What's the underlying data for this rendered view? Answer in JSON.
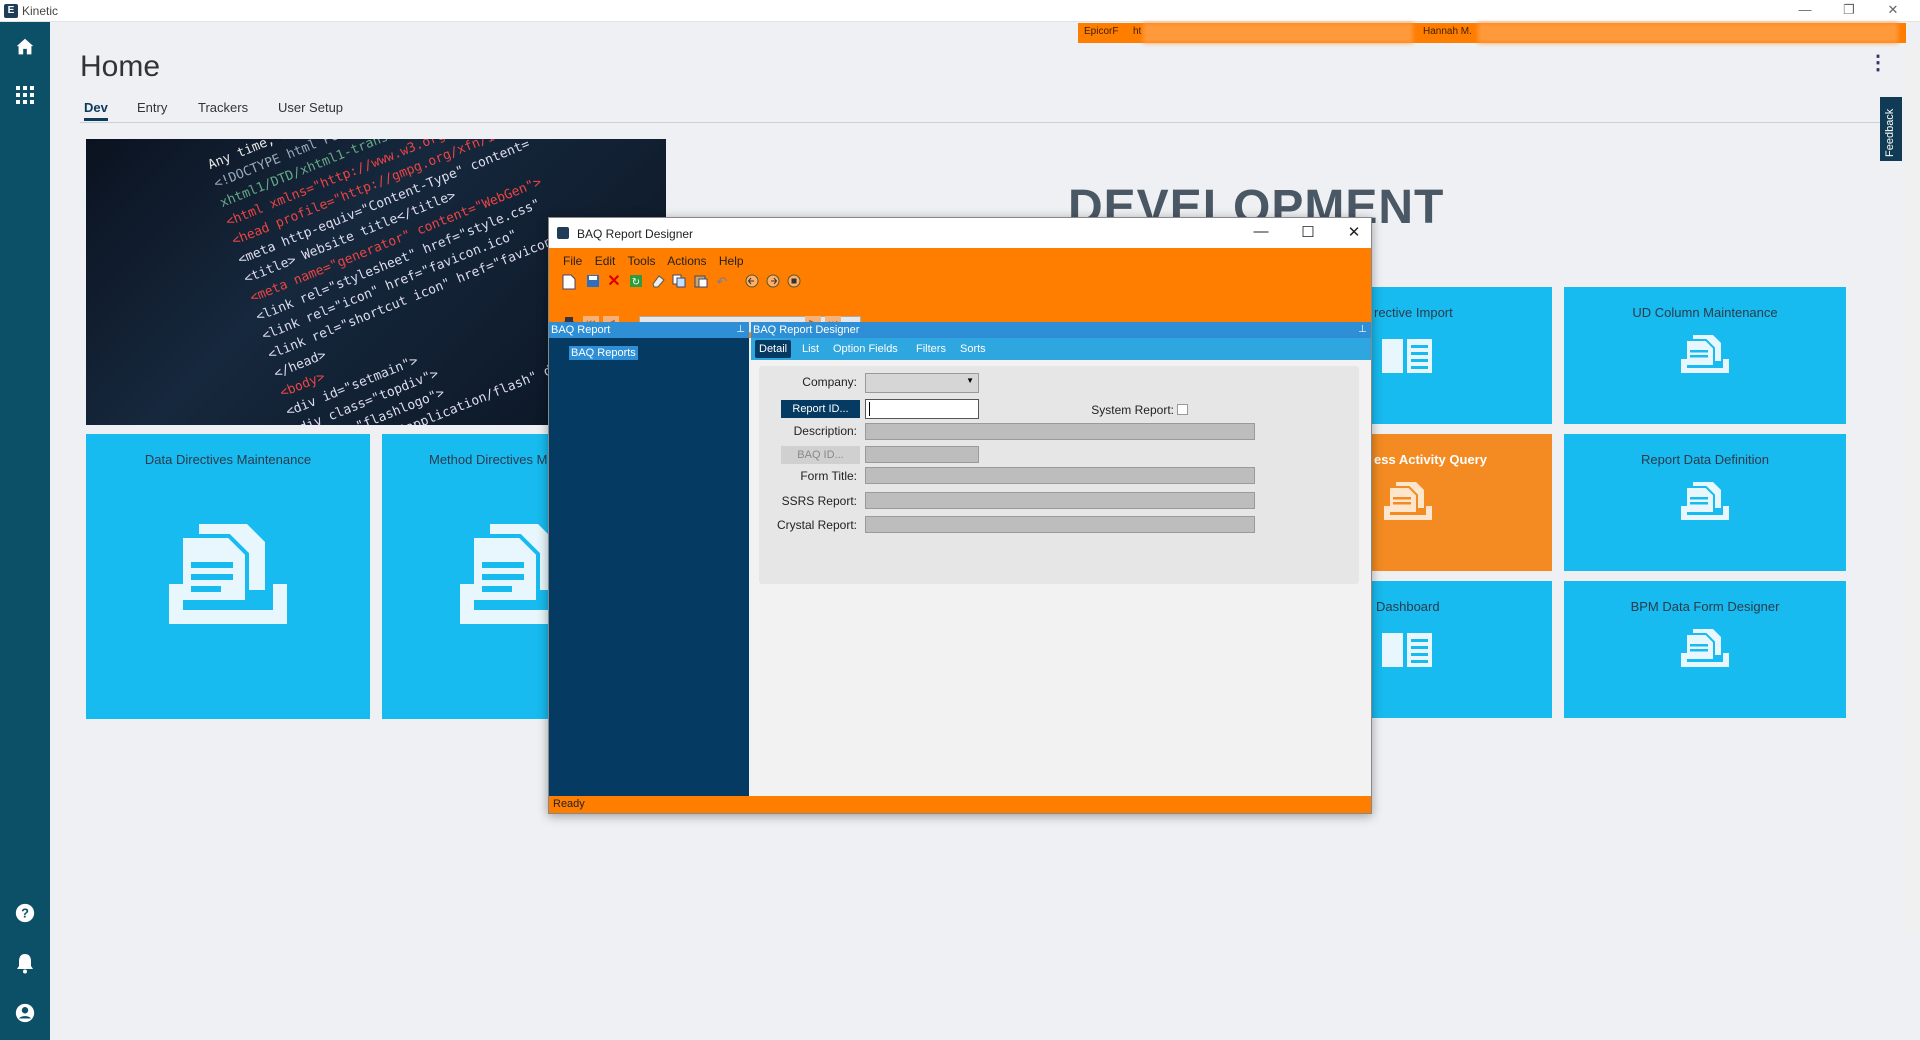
{
  "window": {
    "title": "Kinetic",
    "min": "—",
    "restore": "❐",
    "close": "✕"
  },
  "envbar": {
    "company": "EpicorF",
    "url": "ht",
    "user": "Hannah M."
  },
  "page": {
    "title": "Home",
    "more": "⋮"
  },
  "tabs": [
    "Dev",
    "Entry",
    "Trackers",
    "User Setup"
  ],
  "feedback": "Feedback",
  "hero_code": [
    {
      "t": "Any time, any",
      "c": "#e8e8e8"
    },
    {
      "t": "<!DOCTYPE html PUBLIC \"-//W3C//DTD",
      "c": "#9ab"
    },
    {
      "t": "xhtml1/DTD/xhtml1-transitional.dtd",
      "c": "#6a8"
    },
    {
      "t": "<html xmlns=\"http://www.w3.org/1999/xhtml\"",
      "c": "#e44"
    },
    {
      "t": "<head profile=\"http://gmpg.org/xfn/11\">",
      "c": "#e44"
    },
    {
      "t": "<meta http-equiv=\"Content-Type\" content=",
      "c": "#dde"
    },
    {
      "t": "<title> Website title</title>",
      "c": "#dde"
    },
    {
      "t": "<meta name=\"generator\" content=\"WebGen\">",
      "c": "#e44"
    },
    {
      "t": "<link rel=\"stylesheet\" href=\"style.css\"",
      "c": "#dde"
    },
    {
      "t": "<link rel=\"icon\" href=\"favicon.ico\"",
      "c": "#dde"
    },
    {
      "t": "<link rel=\"shortcut icon\" href=\"favicon\"",
      "c": "#dde"
    },
    {
      "t": "</head>",
      "c": "#dde"
    },
    {
      "t": "<body>",
      "c": "#e44"
    },
    {
      "t": "<div id=\"setmain\">",
      "c": "#dde"
    },
    {
      "t": "<div class=\"topdiv\">",
      "c": "#dde"
    },
    {
      "t": "<div id=\"flashlogo\">",
      "c": "#dde"
    },
    {
      "t": "<object type=\"application/flash\" data=",
      "c": "#dde"
    }
  ],
  "dev_title": "DEVELOPMENT",
  "tiles": {
    "data_directives": "Data Directives Maintenance",
    "method_directives": "Method Directives M",
    "directive_import": "rective Import",
    "ud_column": "UD Column Maintenance",
    "business_activity": "ess Activity Query",
    "report_data_def": "Report Data Definition",
    "dashboard": "Dashboard",
    "bpm_form": "BPM Data Form Designer"
  },
  "colors": {
    "tile": "#17bbef",
    "tile_orange": "#f38b22",
    "accent": "#ff7e00",
    "sidebar": "#0c5067"
  },
  "dialog": {
    "title": "BAQ Report Designer",
    "min": "—",
    "max": "☐",
    "close": "✕",
    "menu": [
      "File",
      "Edit",
      "Tools",
      "Actions",
      "Help"
    ],
    "left_pane_title": "BAQ Report",
    "tree_node": "BAQ Reports",
    "right_pane_title": "BAQ Report Designer",
    "subtabs": [
      "Detail",
      "List",
      "Option Fields",
      "Filters",
      "Sorts"
    ],
    "form": {
      "company_label": "Company:",
      "report_id_button": "Report ID...",
      "system_report_label": "System Report:",
      "description_label": "Description:",
      "baq_id_button": "BAQ ID...",
      "form_title_label": "Form Title:",
      "ssrs_label": "SSRS Report:",
      "crystal_label": "Crystal Report:"
    },
    "pin": "⊥",
    "status": "Ready"
  }
}
